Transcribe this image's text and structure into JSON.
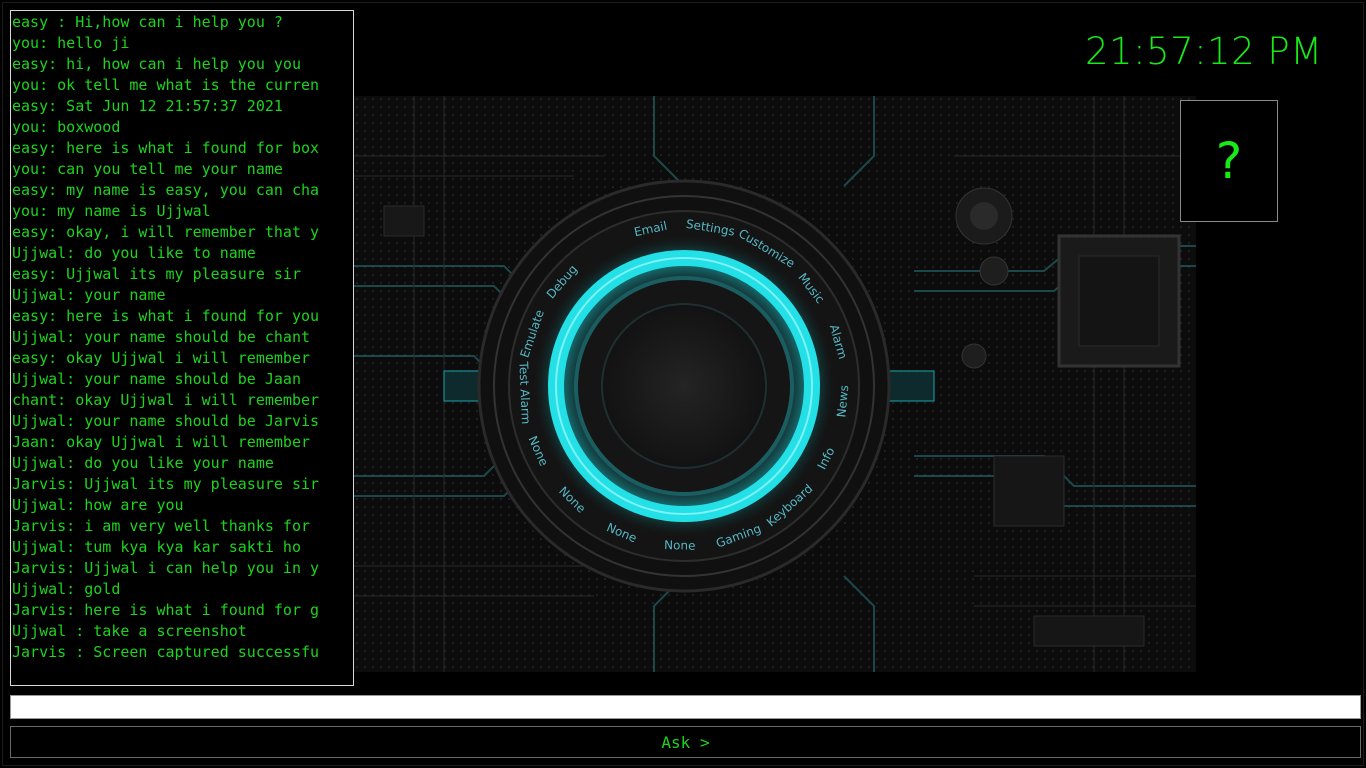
{
  "chat": {
    "lines": [
      "easy : Hi,how can i help you ?",
      "you: hello ji",
      "easy: hi, how can i help you you",
      "you: ok tell me what is the curren",
      "easy: Sat Jun 12 21:57:37 2021",
      "you: boxwood",
      "easy: here is what i found for box",
      "you: can you tell me your name",
      "easy: my name is easy, you can cha",
      "you: my name is Ujjwal",
      "easy: okay, i will remember that y",
      "Ujjwal: do you like to name",
      "easy: Ujjwal its my pleasure sir",
      "Ujjwal: your name",
      "easy: here is what i found for you",
      "Ujjwal: your name should be chant",
      "easy: okay Ujjwal i will remember",
      "Ujjwal: your name should be Jaan",
      "chant: okay Ujjwal i will remember",
      "Ujjwal: your name should be Jarvis",
      "Jaan: okay Ujjwal i will remember",
      "Ujjwal: do you like your name",
      "Jarvis: Ujjwal its my pleasure sir",
      "Ujjwal: how are you",
      "Jarvis: i am very well thanks for",
      "Ujjwal: tum kya kya kar sakti ho",
      "Jarvis: Ujjwal i can help you in y",
      "Ujjwal: gold",
      "Jarvis: here is what i found for g",
      "Ujjwal : take a screenshot",
      "Jarvis : Screen captured successfu"
    ]
  },
  "clock": {
    "time": "21:57:12 PM"
  },
  "avatar": {
    "placeholder": "?"
  },
  "menu": {
    "items": [
      "Email",
      "Settings",
      "Customize",
      "Music",
      "Alarm",
      "News",
      "Info",
      "Keyboard",
      "Gaming",
      "None",
      "None",
      "None",
      "None",
      "Test Alarm",
      "Emulate",
      "Debug"
    ]
  },
  "input": {
    "value": "",
    "placeholder": ""
  },
  "ask_button": {
    "label": "Ask >"
  },
  "colors": {
    "text_green": "#1cd41c",
    "ring_cyan": "#22e0e6",
    "background": "#000000"
  }
}
